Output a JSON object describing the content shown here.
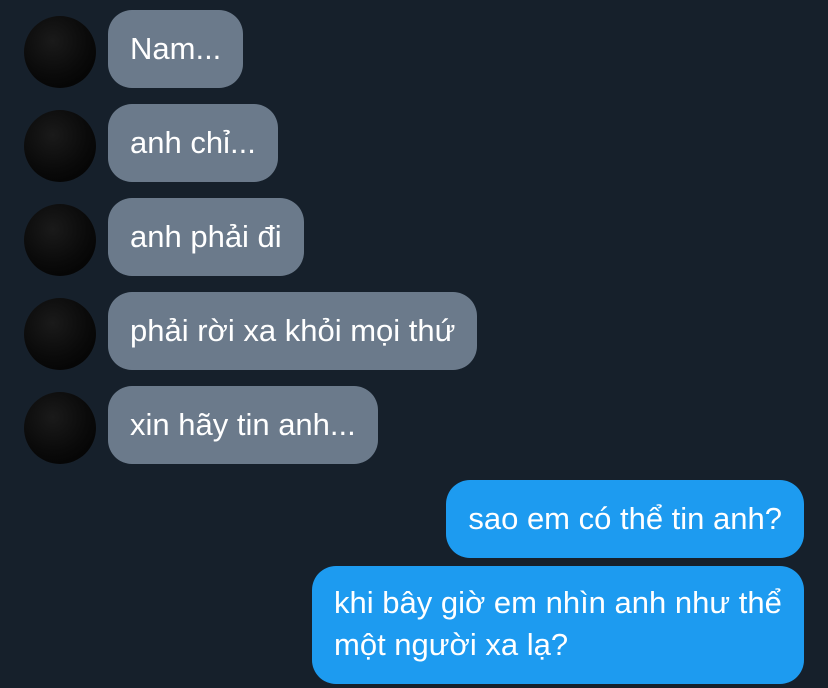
{
  "conversation": {
    "incoming": [
      {
        "text": "Nam..."
      },
      {
        "text": "anh chỉ..."
      },
      {
        "text": "anh phải đi"
      },
      {
        "text": "phải rời xa khỏi mọi thứ"
      },
      {
        "text": "xin hãy tin anh..."
      }
    ],
    "outgoing": [
      {
        "text": "sao em có thể tin anh?"
      },
      {
        "text": "khi bây giờ em nhìn anh như thể một người xa lạ?"
      }
    ]
  },
  "colors": {
    "background": "#16202b",
    "incoming_bubble": "#6b7a8b",
    "outgoing_bubble": "#1d9bf0",
    "text": "#ffffff"
  }
}
